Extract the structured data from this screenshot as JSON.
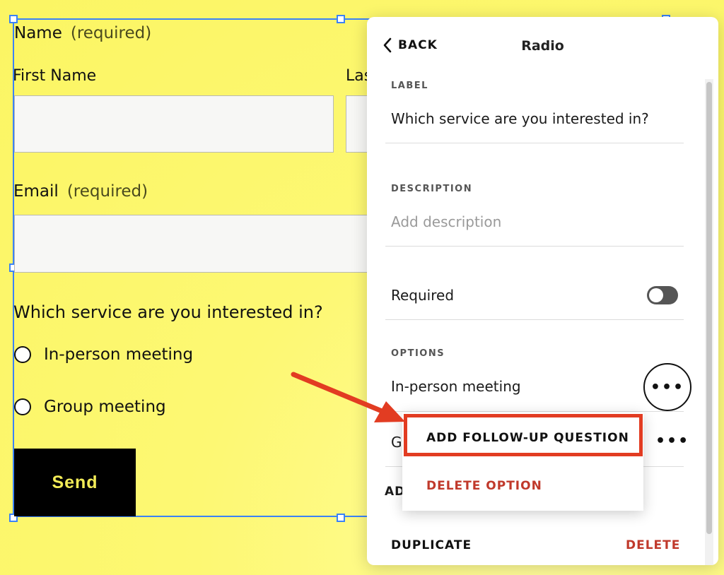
{
  "form": {
    "name_label": "Name",
    "name_required": "(required)",
    "first_name_label": "First Name",
    "last_name_label": "Las",
    "email_label": "Email",
    "email_required": "(required)",
    "question": "Which service are you interested in?",
    "options": [
      "In-person meeting",
      "Group meeting"
    ],
    "send_label": "Send"
  },
  "panel": {
    "back_label": "BACK",
    "title": "Radio",
    "label_caption": "LABEL",
    "label_value": "Which service are you interested in?",
    "description_caption": "DESCRIPTION",
    "description_placeholder": "Add description",
    "required_label": "Required",
    "required_on": false,
    "options_caption": "OPTIONS",
    "options": [
      "In-person meeting",
      "G"
    ],
    "add_option_partial": "AD",
    "duplicate_label": "DUPLICATE",
    "delete_label": "DELETE"
  },
  "menu": {
    "add_follow_up": "ADD FOLLOW-UP QUESTION",
    "delete_option": "DELETE OPTION"
  },
  "colors": {
    "canvas": "#fbf563",
    "selection": "#3b82f6",
    "send_bg": "#000000",
    "send_text": "#f3ec57",
    "danger": "#c0392b",
    "annotation": "#e23c22"
  },
  "icons": {
    "back": "chevron-left-icon",
    "more": "more-dots-icon",
    "annotation": "arrow-icon"
  }
}
